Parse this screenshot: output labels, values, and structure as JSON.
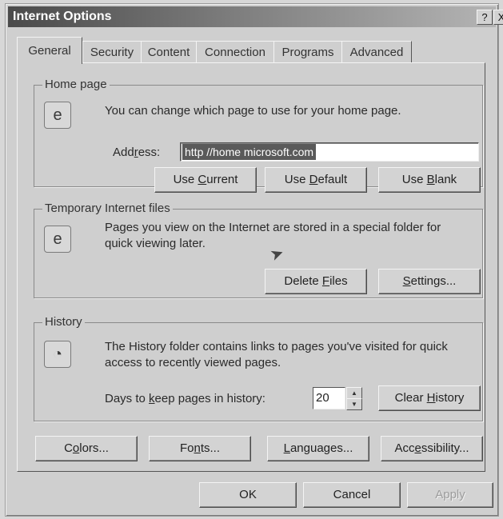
{
  "window": {
    "title": "Internet Options",
    "help_button": "?",
    "close_button": "X"
  },
  "tabs": [
    {
      "label": "General",
      "active": true
    },
    {
      "label": "Security",
      "active": false
    },
    {
      "label": "Content",
      "active": false
    },
    {
      "label": "Connection",
      "active": false
    },
    {
      "label": "Programs",
      "active": false
    },
    {
      "label": "Advanced",
      "active": false
    }
  ],
  "home_page": {
    "title": "Home page",
    "icon": "home-page-icon",
    "description": "You can change which page to use for your home page.",
    "address_label_prefix": "Add",
    "address_label_key": "r",
    "address_label_suffix": "ess:",
    "address_value": "http //home microsoft.com",
    "use_current": {
      "prefix": "Use ",
      "key": "C",
      "suffix": "urrent"
    },
    "use_default": {
      "prefix": "Use ",
      "key": "D",
      "suffix": "efault"
    },
    "use_blank": {
      "prefix": "Use ",
      "key": "B",
      "suffix": "lank"
    }
  },
  "temp_files": {
    "title": "Temporary Internet files",
    "icon": "temporary-files-icon",
    "description_line1": "Pages you view on the Internet are stored in a special folder for",
    "description_line2": "quick viewing later.",
    "delete_files": {
      "prefix": "Delete ",
      "key": "F",
      "suffix": "iles"
    },
    "settings": {
      "prefix": "",
      "key": "S",
      "suffix": "ettings..."
    }
  },
  "history": {
    "title": "History",
    "icon": "history-icon",
    "description_line1": "The History folder contains links to pages you've visited for quick",
    "description_line2": "access to recently viewed pages.",
    "days_label_prefix": "Days to ",
    "days_label_key": "k",
    "days_label_suffix": "eep pages in history:",
    "days_value": "20",
    "clear_history": {
      "prefix": "Clear ",
      "key": "H",
      "suffix": "istory"
    }
  },
  "bottom_buttons": {
    "colors": {
      "prefix": "C",
      "key": "o",
      "suffix": "lors..."
    },
    "fonts": {
      "prefix": "Fo",
      "key": "n",
      "suffix": "ts..."
    },
    "languages": {
      "prefix": "",
      "key": "L",
      "suffix": "anguages..."
    },
    "accessibility": {
      "prefix": "Acc",
      "key": "e",
      "suffix": "ssibility..."
    }
  },
  "dialog_buttons": {
    "ok": "OK",
    "cancel": "Cancel",
    "apply": "Apply"
  }
}
